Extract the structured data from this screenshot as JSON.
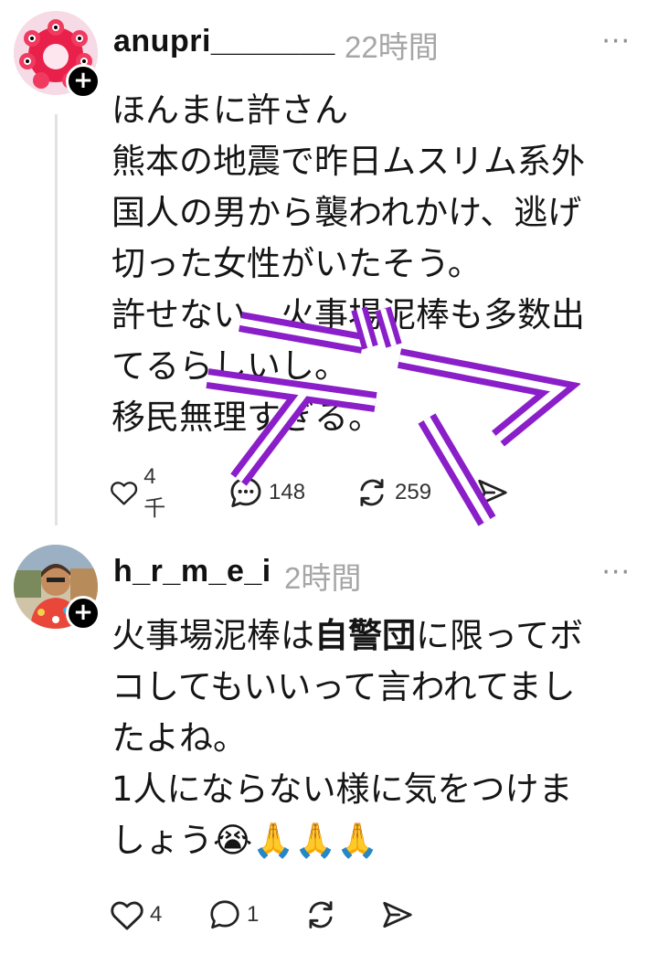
{
  "posts": [
    {
      "username": "anupri_______",
      "time": "22時間",
      "more": "···",
      "follow": "+",
      "lines": [
        "ほんまに許さん",
        "熊本の地震で昨日ムスリム系外",
        "国人の男から襲われかけ、逃げ",
        "切った女性がいたそう。",
        "許せない。火事場泥棒も多数出",
        "てるらしいし。",
        "移民無理すぎる。"
      ],
      "actions": {
        "like": "4千",
        "reply": "148",
        "repost": "259",
        "share": ""
      }
    },
    {
      "username": "h_r_m_e_i",
      "time": "2時間",
      "more": "···",
      "follow": "+",
      "lines_html": {
        "l1_a": "火事場泥棒は",
        "l1_b": "自警団",
        "l1_c": "に限ってボ",
        "l2": "コしてもいいって言われてまし",
        "l3": "たよね。",
        "l4": "1人にならない様に気をつけま",
        "l5": "しょう😭🙏🙏🙏"
      },
      "actions": {
        "like": "4",
        "reply": "1",
        "repost": "",
        "share": ""
      }
    }
  ],
  "overlay": {
    "text": "デマ",
    "color": "#8a1ec8"
  }
}
